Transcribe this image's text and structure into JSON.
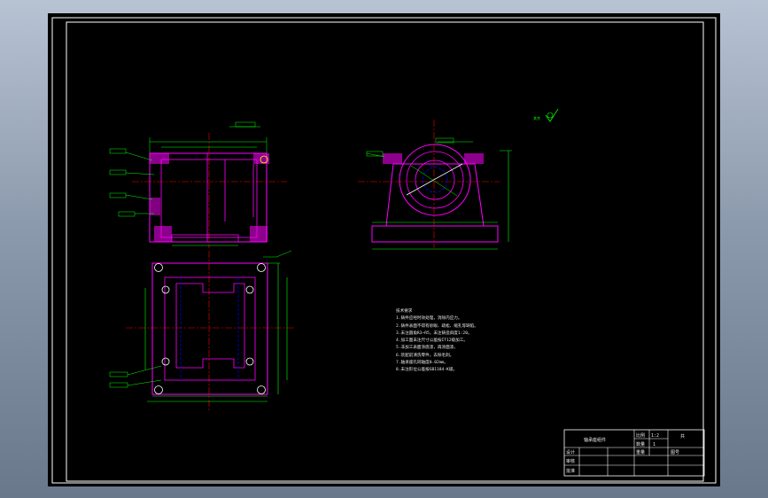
{
  "drawing": {
    "notes_title": "技术要求",
    "notes": [
      "1.铸件应经时效处理，消除内应力。",
      "2.铸件表面不得有砂眼、疏松、缩孔等缺陷。",
      "3.未注圆角R3~R5，未注铸造斜度1:20。",
      "4.加工面未注尺寸公差按IT12级加工。",
      "5.非加工表面涂底漆，再涂面漆。",
      "6.装配前清洗零件，去除毛刺。",
      "7.轴承座孔同轴度0.02mm。",
      "8.未注形位公差按GB1184-K级。"
    ],
    "roughness_mark": "其余",
    "title_block": {
      "part_name": "轴承座组件",
      "scale_label": "比例",
      "scale_value": "1:2",
      "qty_label": "数量",
      "qty_value": "1",
      "sheet": "共",
      "designer": "设计",
      "checker": "审核",
      "approver": "批准",
      "material": "重量",
      "drawing_no": "图号"
    }
  },
  "colors": {
    "outline": "#ffffff",
    "part": "#ff00ff",
    "dimension": "#00ff00",
    "centerline": "#ff0000",
    "hidden": "#0000ff",
    "section": "#ffff00"
  }
}
